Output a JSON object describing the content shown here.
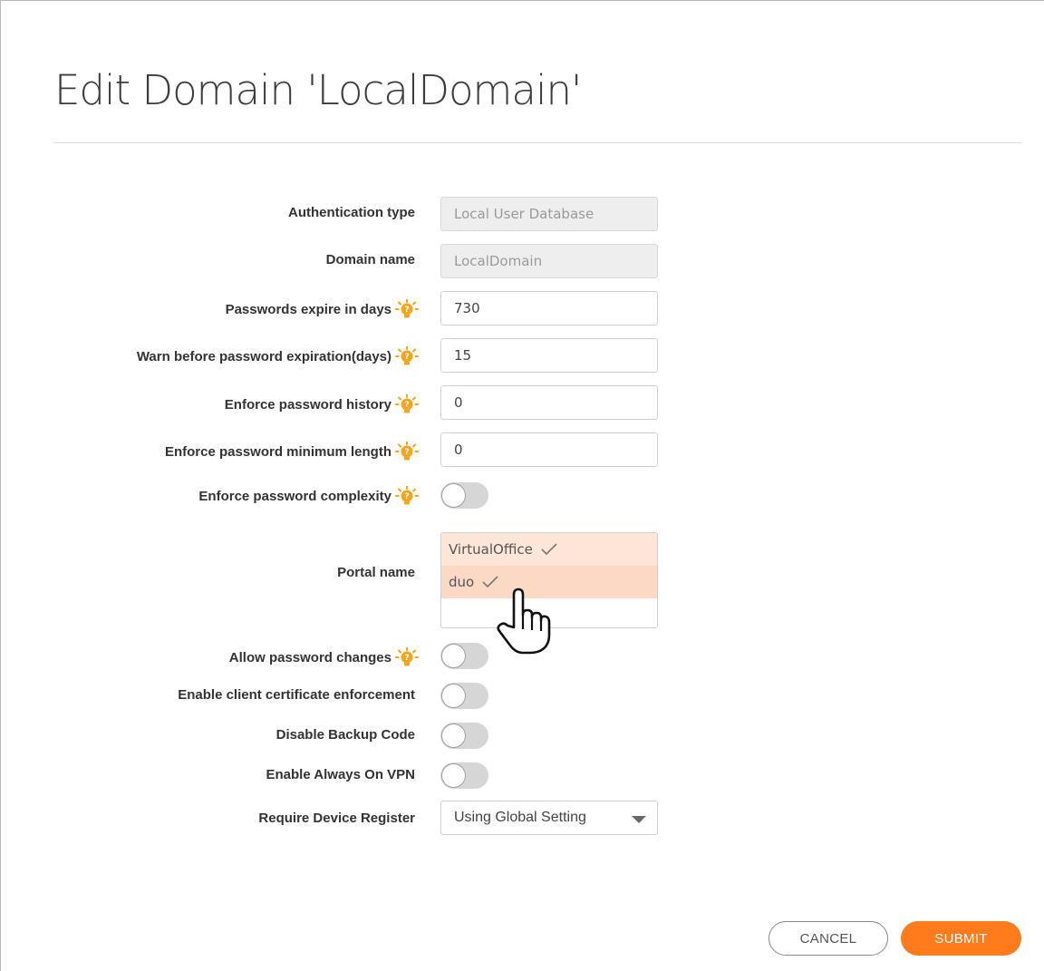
{
  "dialog": {
    "title": "Edit Domain 'LocalDomain'"
  },
  "fields": {
    "auth_type": {
      "label": "Authentication type",
      "value": "Local User Database"
    },
    "domain_name": {
      "label": "Domain name",
      "value": "LocalDomain"
    },
    "password_expire": {
      "label": "Passwords expire in days",
      "value": "730"
    },
    "warn_before": {
      "label": "Warn before password expiration(days)",
      "value": "15"
    },
    "password_history": {
      "label": "Enforce password history",
      "value": "0"
    },
    "min_length": {
      "label": "Enforce password minimum length",
      "value": "0"
    },
    "complexity": {
      "label": "Enforce password complexity",
      "enabled": false
    },
    "portal_name": {
      "label": "Portal name",
      "options": [
        {
          "label": "VirtualOffice",
          "selected": true
        },
        {
          "label": "duo",
          "selected": true
        }
      ]
    },
    "allow_password_changes": {
      "label": "Allow password changes",
      "enabled": false
    },
    "client_cert": {
      "label": "Enable client certificate enforcement",
      "enabled": false
    },
    "disable_backup_code": {
      "label": "Disable Backup Code",
      "enabled": false
    },
    "always_on_vpn": {
      "label": "Enable Always On VPN",
      "enabled": false
    },
    "require_device_register": {
      "label": "Require Device Register",
      "value": "Using Global Setting"
    }
  },
  "buttons": {
    "cancel": "CANCEL",
    "submit": "SUBMIT"
  },
  "colors": {
    "accent": "#ff7b1c",
    "hint_icon": "#f7a51c",
    "selected_option_bg": "#fde5d8",
    "toggle_off": "#d6d6d6"
  },
  "icons": {
    "hint": "lightbulb-hint-icon",
    "check": "check-icon",
    "caret": "chevron-down-icon",
    "cursor": "hand-pointer-cursor-icon"
  }
}
